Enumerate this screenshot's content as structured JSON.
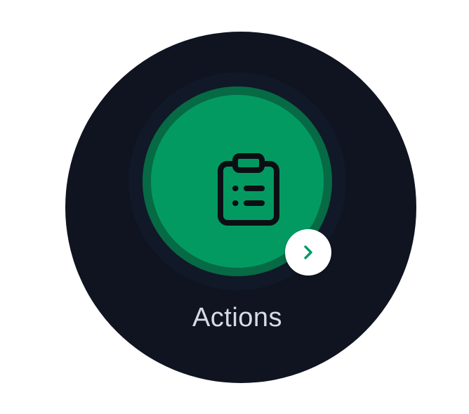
{
  "tile": {
    "label": "Actions",
    "icon": "clipboard-list-icon",
    "badge_icon": "chevron-right-icon"
  },
  "colors": {
    "face_background": "#0f1420",
    "halo": "#111827",
    "button_ring": "#066a45",
    "button_fill": "#039a62",
    "icon_stroke": "#0b0f14",
    "badge_background": "#ffffff",
    "badge_chevron": "#039a62",
    "label_text": "#d7dbe6"
  }
}
